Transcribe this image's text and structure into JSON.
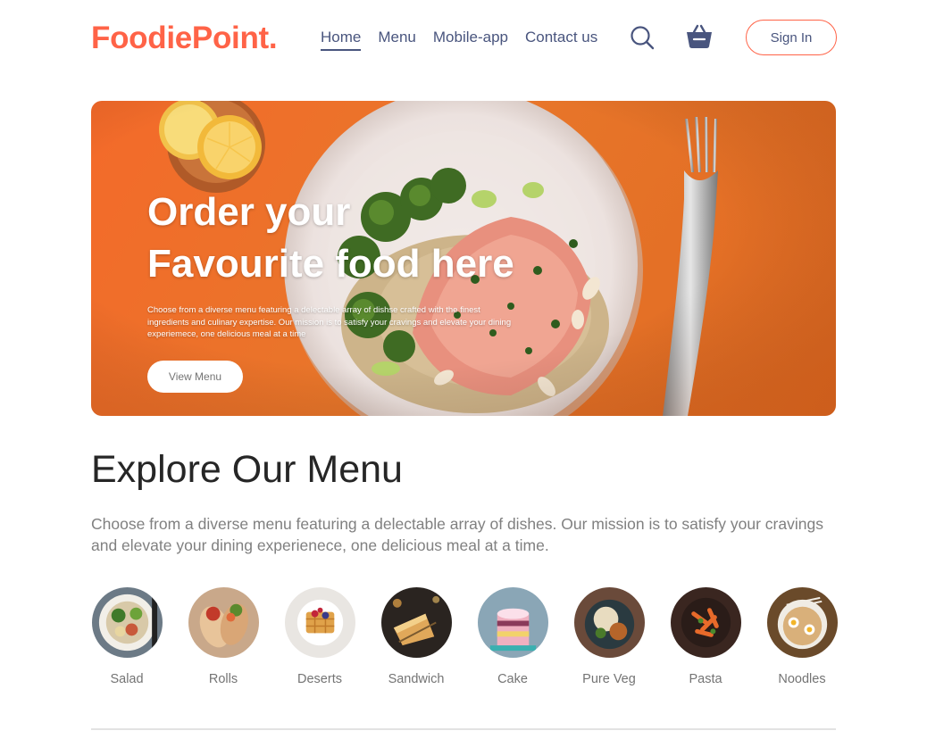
{
  "navbar": {
    "logo": "FoodiePoint.",
    "menu": [
      {
        "label": "Home",
        "active": true
      },
      {
        "label": "Menu",
        "active": false
      },
      {
        "label": "Mobile-app",
        "active": false
      },
      {
        "label": "Contact us",
        "active": false
      }
    ],
    "search_icon": "search-icon",
    "basket_icon": "basket-icon",
    "signin_label": "Sign In"
  },
  "hero": {
    "title_line1": "Order your",
    "title_line2": "Favourite food here",
    "description": "Choose from a diverse menu featuring a delectable array of dishse crafted with the finest ingredients and culinary expertise. Our mission is to satisfy your cravings and elevate your dining experiemece, one delicious meal at a time",
    "button_label": "View Menu"
  },
  "explore": {
    "title": "Explore Our Menu",
    "description": "Choose from a diverse menu featuring a delectable array of dishes. Our mission is to satisfy your cravings and elevate your dining experienece, one delicious meal at a time."
  },
  "categories": [
    {
      "label": "Salad"
    },
    {
      "label": "Rolls"
    },
    {
      "label": "Deserts"
    },
    {
      "label": "Sandwich"
    },
    {
      "label": "Cake"
    },
    {
      "label": "Pure Veg"
    },
    {
      "label": "Pasta"
    },
    {
      "label": "Noodles"
    }
  ],
  "colors": {
    "brand": "#ff6347",
    "nav_text": "#49557e",
    "hero_orange": "#ec6f2a",
    "heading": "#262626",
    "muted": "#808080"
  }
}
